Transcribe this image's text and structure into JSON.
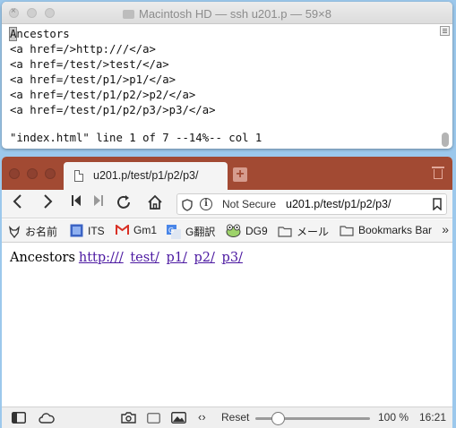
{
  "terminal": {
    "title": "Macintosh HD — ssh u201.p — 59×8",
    "cursor_char": "A",
    "first_line_rest": "ncestors",
    "lines": [
      "<a href=/>http:///</a>",
      "<a href=/test/>test/</a>",
      "<a href=/test/p1/>p1/</a>",
      "<a href=/test/p1/p2/>p2/</a>",
      "<a href=/test/p1/p2/p3/>p3/</a>"
    ],
    "status_line": "\"index.html\" line 1 of 7 --14%-- col 1"
  },
  "browser": {
    "tab_title": "u201.p/test/p1/p2/p3/",
    "new_tab_glyph": "+",
    "url": {
      "security_label": "Not Secure",
      "address": "u201.p/test/p1/p2/p3/"
    },
    "bookmarks": [
      {
        "label": "お名前",
        "icon": "fox-icon"
      },
      {
        "label": "ITS",
        "icon": "its-icon"
      },
      {
        "label": "Gm1",
        "icon": "gmail-icon"
      },
      {
        "label": "G翻訳",
        "icon": "google-translate-icon"
      },
      {
        "label": "DG9",
        "icon": "frog-icon"
      },
      {
        "label": "メール",
        "icon": "folder-icon"
      },
      {
        "label": "Bookmarks Bar",
        "icon": "folder-icon"
      }
    ],
    "page": {
      "heading": "Ancestors",
      "links": [
        "http:///",
        "test/",
        "p1/",
        "p2/",
        "p3/"
      ]
    },
    "status": {
      "reset_label": "Reset",
      "zoom": "100 %",
      "zoom_fraction": 0.14,
      "time": "16:21"
    }
  },
  "colors": {
    "tabbar": "#a24a33",
    "link": "#4b18a1",
    "desktop": "#9cc8ec"
  }
}
